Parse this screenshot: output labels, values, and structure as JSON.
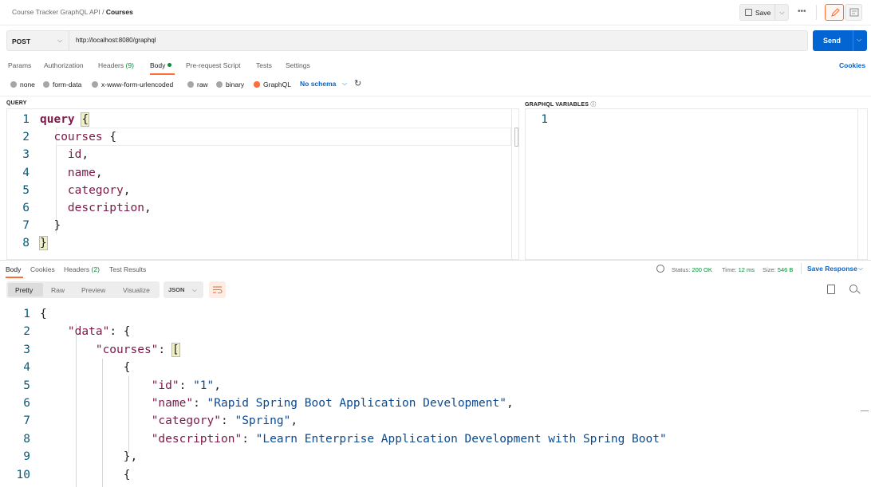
{
  "header": {
    "breadcrumb_parent": "Course Tracker GraphQL API",
    "breadcrumb_sep": "/",
    "breadcrumb_current": "Courses",
    "save_label": "Save",
    "more_label": "•••"
  },
  "request": {
    "method": "POST",
    "url": "http://localhost:8080/graphql",
    "send_label": "Send"
  },
  "request_tabs": {
    "params": "Params",
    "authorization": "Authorization",
    "headers": "Headers",
    "headers_count": "(9)",
    "body": "Body",
    "pre_request": "Pre-request Script",
    "tests": "Tests",
    "settings": "Settings",
    "cookies": "Cookies"
  },
  "body_types": {
    "none": "none",
    "form_data": "form-data",
    "urlencoded": "x-www-form-urlencoded",
    "raw": "raw",
    "binary": "binary",
    "graphql": "GraphQL",
    "schema": "No schema",
    "selected": "GraphQL"
  },
  "query_pane": {
    "title": "QUERY",
    "lines": [
      "1",
      "2",
      "3",
      "4",
      "5",
      "6",
      "7",
      "8"
    ],
    "tokens": {
      "query": "query",
      "courses": "courses",
      "id": "id",
      "name": "name",
      "category": "category",
      "description": "description"
    }
  },
  "variables_pane": {
    "title": "GRAPHQL VARIABLES",
    "info": "ⓘ",
    "lines": [
      "1"
    ]
  },
  "response_tabs": {
    "body": "Body",
    "cookies": "Cookies",
    "headers": "Headers",
    "headers_count": "(2)",
    "test_results": "Test Results"
  },
  "response_meta": {
    "status_label": "Status:",
    "status_value": "200 OK",
    "time_label": "Time:",
    "time_value": "12 ms",
    "size_label": "Size:",
    "size_value": "546 B",
    "save_response": "Save Response"
  },
  "response_view": {
    "pretty": "Pretty",
    "raw": "Raw",
    "preview": "Preview",
    "visualize": "Visualize",
    "format": "JSON"
  },
  "response_body": {
    "lines": [
      "1",
      "2",
      "3",
      "4",
      "5",
      "6",
      "7",
      "8",
      "9",
      "10"
    ],
    "data_key": "\"data\"",
    "courses_key": "\"courses\"",
    "id_key": "\"id\"",
    "id_val": "\"1\"",
    "name_key": "\"name\"",
    "name_val": "\"Rapid Spring Boot Application Development\"",
    "category_key": "\"category\"",
    "category_val": "\"Spring\"",
    "description_key": "\"description\"",
    "description_val": "\"Learn Enterprise Application Development with Spring Boot\""
  },
  "colors": {
    "accent": "#ff6c37",
    "primary": "#0265d2",
    "success": "#0a8a3b"
  }
}
